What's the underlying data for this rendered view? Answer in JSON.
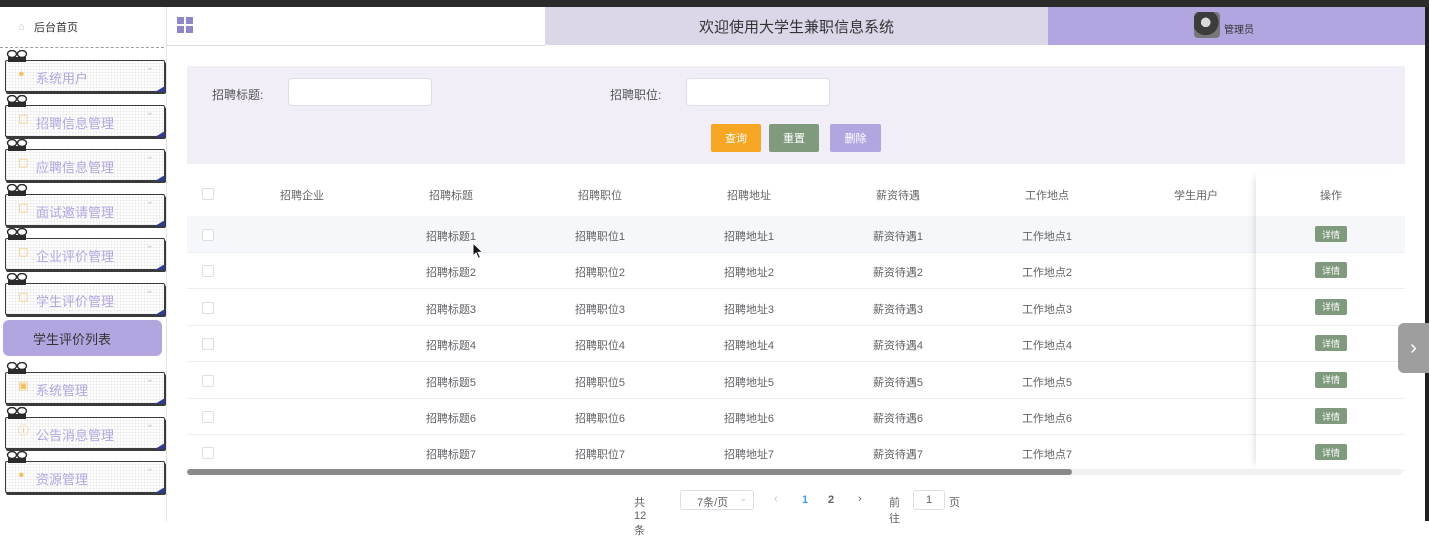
{
  "window": {
    "header_title": "欢迎使用大学生兼职信息系统",
    "admin_label": "管理员"
  },
  "sidebar": {
    "home": "后台首页",
    "items": [
      {
        "label": "系统用户",
        "icon": "user-icon"
      },
      {
        "label": "招聘信息管理",
        "icon": "doc-icon"
      },
      {
        "label": "应聘信息管理",
        "icon": "doc-icon"
      },
      {
        "label": "面试邀请管理",
        "icon": "doc-icon"
      },
      {
        "label": "企业评价管理",
        "icon": "doc-icon"
      },
      {
        "label": "学生评价管理",
        "icon": "doc-icon"
      }
    ],
    "active_sub": "学生评价列表",
    "items_after": [
      {
        "label": "系统管理",
        "icon": "picture-icon"
      },
      {
        "label": "公告消息管理",
        "icon": "info-icon"
      },
      {
        "label": "资源管理",
        "icon": "bulb-icon"
      }
    ]
  },
  "search": {
    "title_label": "招聘标题:",
    "title_value": "",
    "position_label": "招聘职位:",
    "position_value": "",
    "query_button": "查询",
    "reset_button": "重置",
    "delete_button": "删除"
  },
  "table": {
    "headers": [
      "招聘企业",
      "招聘标题",
      "招聘职位",
      "招聘地址",
      "薪资待遇",
      "工作地点",
      "学生用户",
      "操作"
    ],
    "rows": [
      [
        "",
        "招聘标题1",
        "招聘职位1",
        "招聘地址1",
        "薪资待遇1",
        "工作地点1",
        ""
      ],
      [
        "",
        "招聘标题2",
        "招聘职位2",
        "招聘地址2",
        "薪资待遇2",
        "工作地点2",
        ""
      ],
      [
        "",
        "招聘标题3",
        "招聘职位3",
        "招聘地址3",
        "薪资待遇3",
        "工作地点3",
        ""
      ],
      [
        "",
        "招聘标题4",
        "招聘职位4",
        "招聘地址4",
        "薪资待遇4",
        "工作地点4",
        ""
      ],
      [
        "",
        "招聘标题5",
        "招聘职位5",
        "招聘地址5",
        "薪资待遇5",
        "工作地点5",
        ""
      ],
      [
        "",
        "招聘标题6",
        "招聘职位6",
        "招聘地址6",
        "薪资待遇6",
        "工作地点6",
        ""
      ],
      [
        "",
        "招聘标题7",
        "招聘职位7",
        "招聘地址7",
        "薪资待遇7",
        "工作地点7",
        ""
      ]
    ],
    "detail_button": "详情"
  },
  "pagination": {
    "total": "共 12 条",
    "page_size": "7条/页",
    "pages": [
      "1",
      "2"
    ],
    "current_page": "1",
    "goto_label": "前往",
    "goto_value": "1",
    "page_suffix": "页"
  },
  "colors": {
    "accent": "#b3a6e0",
    "query": "#f5a623",
    "reset": "#7f9a7d",
    "header_mid": "#dcd7e8"
  }
}
